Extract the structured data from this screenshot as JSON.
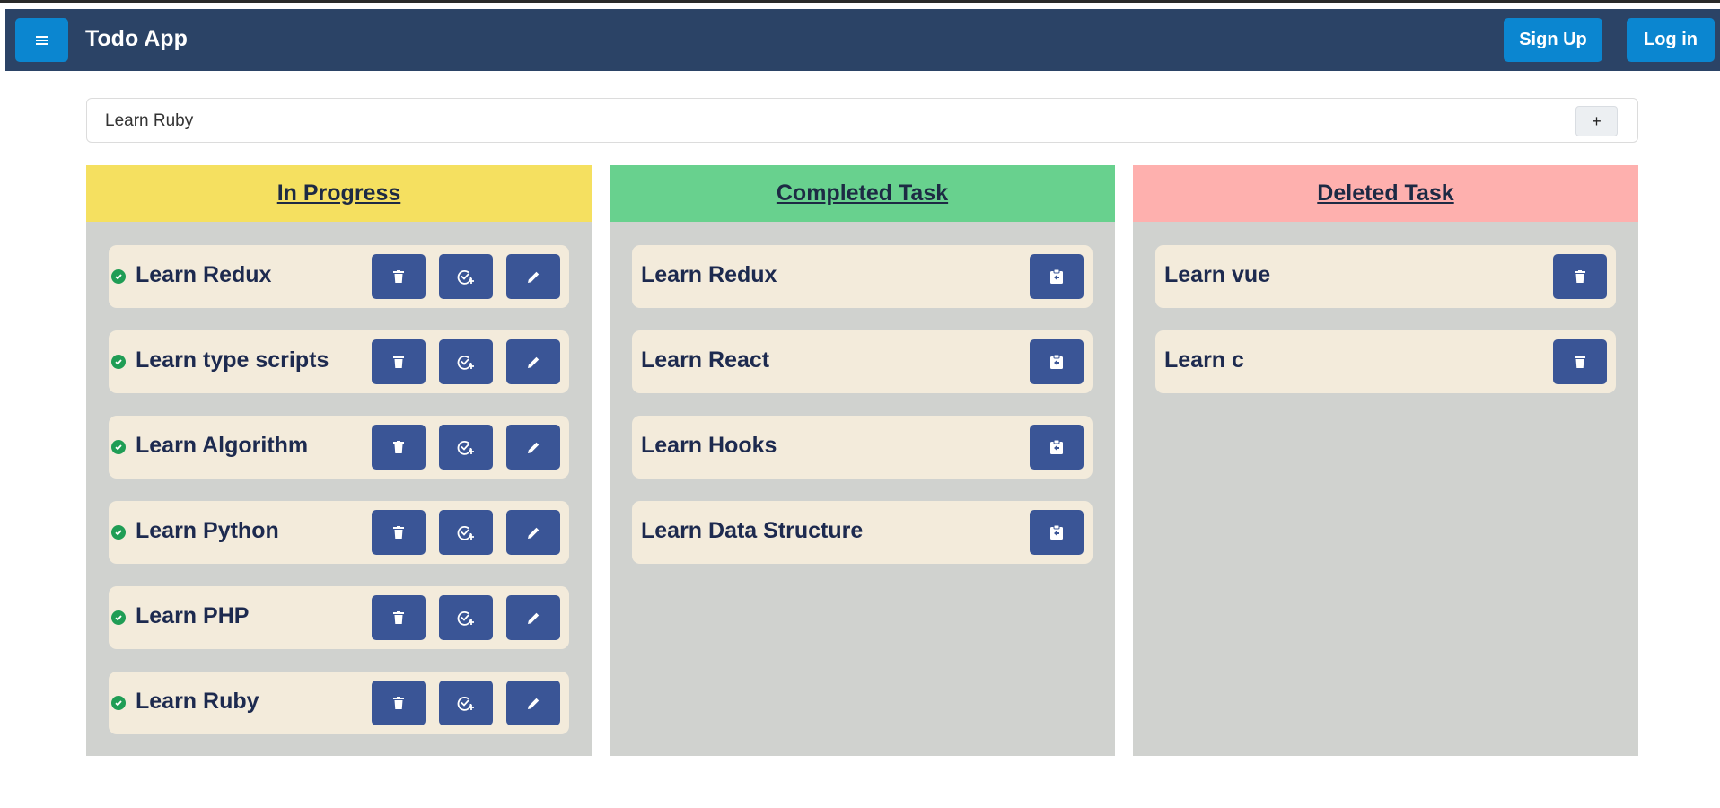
{
  "app": {
    "title": "Todo App"
  },
  "nav": {
    "signup_label": "Sign Up",
    "login_label": "Log in",
    "menu_icon": "hamburger-icon"
  },
  "colors": {
    "navbar": "#2b4366",
    "button_primary": "#0b86d0",
    "action_button": "#3a5596",
    "in_progress": "#f5e060",
    "completed": "#68d18e",
    "deleted": "#feb0ae",
    "card": "#f3ebdb",
    "column_body": "#d0d2cf"
  },
  "input": {
    "value": "Learn Ruby",
    "add_label": "+"
  },
  "columns": {
    "in_progress": {
      "title": "In Progress",
      "tasks": [
        "Learn Redux",
        "Learn type scripts",
        "Learn Algorithm",
        "Learn Python",
        "Learn PHP",
        "Learn Ruby"
      ],
      "actions": [
        "trash-icon",
        "check-circle-plus-icon",
        "pencil-icon"
      ]
    },
    "completed": {
      "title": "Completed Task",
      "tasks": [
        "Learn Redux",
        "Learn React",
        "Learn Hooks",
        "Learn Data Structure"
      ],
      "actions": [
        "clipboard-restore-icon"
      ]
    },
    "deleted": {
      "title": "Deleted Task",
      "tasks": [
        "Learn vue",
        "Learn c"
      ],
      "actions": [
        "trash-icon"
      ]
    }
  }
}
